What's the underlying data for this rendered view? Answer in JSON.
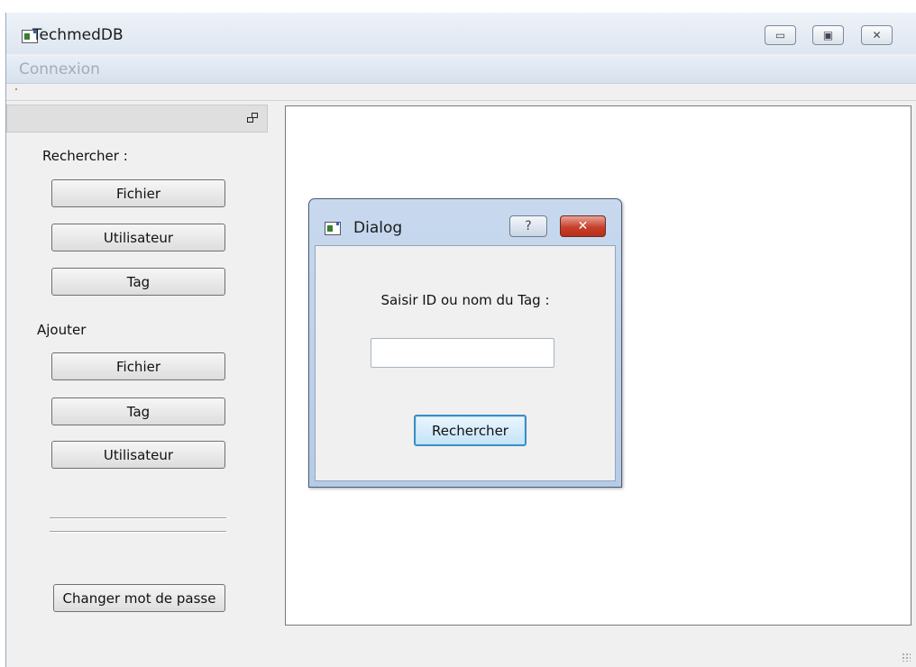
{
  "window": {
    "title": "TechmedDB",
    "icon": "app-window-icon"
  },
  "title_buttons": {
    "minimize": "▭",
    "maximize": "▣",
    "close": "✕"
  },
  "menubar": {
    "items": [
      "Connexion"
    ]
  },
  "sidebar": {
    "search_label": "Rechercher :",
    "search_buttons": [
      "Fichier",
      "Utilisateur",
      "Tag"
    ],
    "add_label": "Ajouter",
    "add_buttons": [
      "Fichier",
      "Tag",
      "Utilisateur"
    ],
    "change_password": "Changer mot de passe"
  },
  "dialog": {
    "title": "Dialog",
    "help": "?",
    "close": "✕",
    "prompt": "Saisir ID ou nom du Tag :",
    "input_value": "",
    "search_button": "Rechercher"
  },
  "colors": {
    "close_button": "#c7402c",
    "focused_button_border": "#3b8ec4",
    "disabled_menu_text": "#a6acb4"
  }
}
